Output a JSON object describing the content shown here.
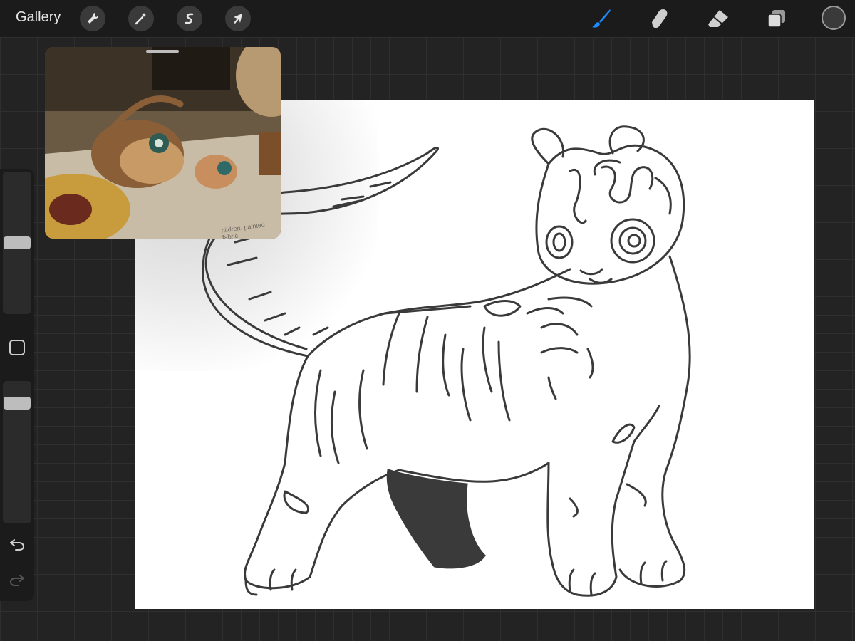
{
  "app": {
    "gallery_label": "Gallery"
  },
  "toolbar_left": [
    {
      "name": "actions",
      "icon": "wrench-icon"
    },
    {
      "name": "adjustments",
      "icon": "magic-wand-icon"
    },
    {
      "name": "selection",
      "icon": "selection-s-icon"
    },
    {
      "name": "transform",
      "icon": "arrow-cursor-icon"
    }
  ],
  "toolbar_right": [
    {
      "name": "brush",
      "icon": "brush-icon",
      "active": true
    },
    {
      "name": "smudge",
      "icon": "smudge-finger-icon"
    },
    {
      "name": "eraser",
      "icon": "eraser-icon"
    },
    {
      "name": "layers",
      "icon": "layers-icon"
    },
    {
      "name": "color",
      "icon": "color-swatch-icon"
    }
  ],
  "colors": {
    "accent": "#1c8dff",
    "current_color": "#3a3a3a",
    "ui_background": "#1b1b1b",
    "canvas": "#ffffff"
  },
  "reference": {
    "caption": "hildren, painted fabric"
  },
  "sidebar": {
    "brush_size": 0.55,
    "opacity": 0.85,
    "undo_icon": "undo-icon",
    "redo_icon": "redo-icon",
    "modify_icon": "square-modify-icon"
  }
}
